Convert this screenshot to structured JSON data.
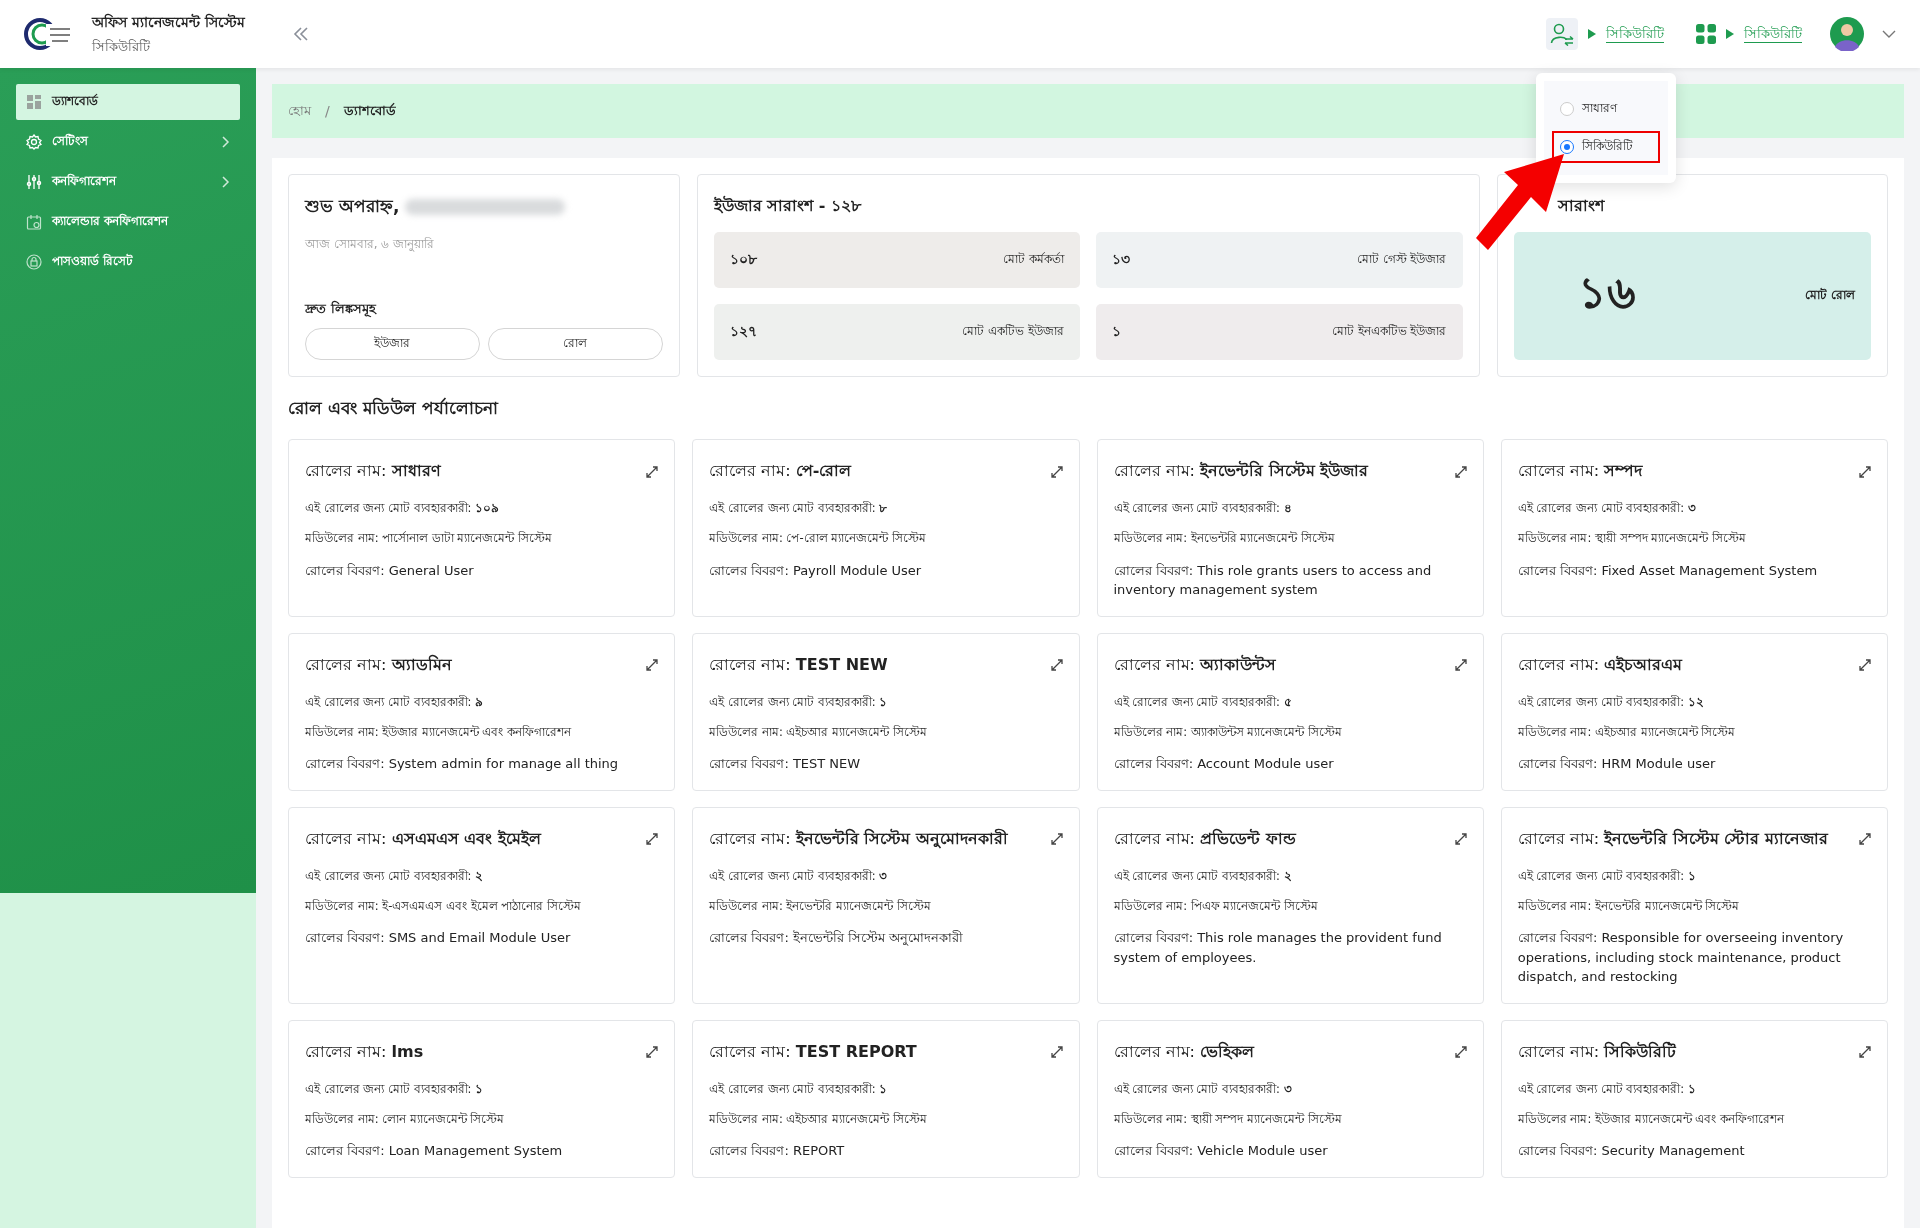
{
  "header": {
    "title": "অফিস ম্যানেজমেন্ট সিস্টেম",
    "subtitle": "সিকিউরিটি",
    "links": [
      "সিকিউরিটি",
      "সিকিউরিটি"
    ]
  },
  "role_menu": {
    "options": [
      {
        "label": "সাধারণ",
        "selected": false,
        "highlighted": false
      },
      {
        "label": "সিকিউরিটি",
        "selected": true,
        "highlighted": true
      }
    ]
  },
  "sidebar": {
    "items": [
      {
        "label": "ড্যাশবোর্ড",
        "selected": true,
        "expandable": false
      },
      {
        "label": "সেটিংস",
        "selected": false,
        "expandable": true
      },
      {
        "label": "কনফিগারেশন",
        "selected": false,
        "expandable": true
      },
      {
        "label": "ক্যালেন্ডার কনফিগারেশন",
        "selected": false,
        "expandable": false
      },
      {
        "label": "পাসওয়ার্ড রিসেট",
        "selected": false,
        "expandable": false
      }
    ]
  },
  "breadcrumb": [
    "হোম",
    "/",
    "ড্যাশবোর্ড"
  ],
  "welcome": {
    "greeting": "শুভ অপরাহ্ন,",
    "date": "আজ সোমবার, ৬ জানুয়ারি",
    "quick_links_title": "দ্রুত লিঙ্কসমূহ",
    "quick_links": [
      "ইউজার",
      "রোল"
    ]
  },
  "user_summary": {
    "title": "ইউজার সারাংশ - ১২৮",
    "stats": [
      {
        "count": "১০৮",
        "caption": "মোট কর্মকর্তা"
      },
      {
        "count": "১৩",
        "caption": "মোট গেস্ট ইউজার"
      },
      {
        "count": "১২৭",
        "caption": "মোট একটিভ ইউজার"
      },
      {
        "count": "১",
        "caption": "মোট ইনএকটিভ ইউজার"
      }
    ]
  },
  "role_summary": {
    "title": "সারাংশ",
    "value": "১৬",
    "label": "মোট রোল"
  },
  "section_title": "রোল এবং মডিউল পর্যালোচনা",
  "roles": [
    {
      "name": "রোলের নাম: **সাধারণ**",
      "users": "এই রোলের জন্য মোট ব্যবহারকারী: **১০৯**",
      "module": "মডিউলের নাম: পার্সোনাল ডাটা ম্যানেজমেন্ট সিস্টেম",
      "description": "রোলের বিবরণ: General User"
    },
    {
      "name": "রোলের নাম: **পে-রোল**",
      "users": "এই রোলের জন্য মোট ব্যবহারকারী: **৮**",
      "module": "মডিউলের নাম: পে-রোল ম্যানেজমেন্ট সিস্টেম",
      "description": "রোলের বিবরণ: Payroll Module User"
    },
    {
      "name": "রোলের নাম: **ইনভেন্টরি সিস্টেম ইউজার**",
      "users": "এই রোলের জন্য মোট ব্যবহারকারী: **৪**",
      "module": "মডিউলের নাম: ইনভেন্টরি ম্যানেজমেন্ট সিস্টেম",
      "description": "রোলের বিবরণ: This role grants users to access and inventory management system"
    },
    {
      "name": "রোলের নাম: **সম্পদ**",
      "users": "এই রোলের জন্য মোট ব্যবহারকারী: **৩**",
      "module": "মডিউলের নাম: স্থায়ী সম্পদ ম্যানেজমেন্ট সিস্টেম",
      "description": "রোলের বিবরণ: Fixed Asset Management System"
    },
    {
      "name": "রোলের নাম: **অ্যাডমিন**",
      "users": "এই রোলের জন্য মোট ব্যবহারকারী: **৯**",
      "module": "মডিউলের নাম: ইউজার ম্যানেজমেন্ট এবং কনফিগারেশন",
      "description": "রোলের বিবরণ: System admin for manage all thing"
    },
    {
      "name": "রোলের নাম: **TEST NEW**",
      "users": "এই রোলের জন্য মোট ব্যবহারকারী: **১**",
      "module": "মডিউলের নাম: এইচআর ম্যানেজমেন্ট সিস্টেম",
      "description": "রোলের বিবরণ: TEST NEW"
    },
    {
      "name": "রোলের নাম: **অ্যাকাউন্টস**",
      "users": "এই রোলের জন্য মোট ব্যবহারকারী: **৫**",
      "module": "মডিউলের নাম: অ্যাকাউন্টস ম্যানেজমেন্ট সিস্টেম",
      "description": "রোলের বিবরণ: Account Module user"
    },
    {
      "name": "রোলের নাম: **এইচআরএম**",
      "users": "এই রোলের জন্য মোট ব্যবহারকারী: **১২**",
      "module": "মডিউলের নাম: এইচআর ম্যানেজমেন্ট সিস্টেম",
      "description": "রোলের বিবরণ: HRM Module user"
    },
    {
      "name": "রোলের নাম: **এসএমএস এবং ইমেইল**",
      "users": "এই রোলের জন্য মোট ব্যবহারকারী: **২**",
      "module": "মডিউলের নাম: ই-এসএমএস এবং ইমেল পাঠানোর সিস্টেম",
      "description": "রোলের বিবরণ: SMS and Email Module User"
    },
    {
      "name": "রোলের নাম: **ইনভেন্টরি সিস্টেম অনুমোদনকারী**",
      "users": "এই রোলের জন্য মোট ব্যবহারকারী: **৩**",
      "module": "মডিউলের নাম: ইনভেন্টরি ম্যানেজমেন্ট সিস্টেম",
      "description": "রোলের বিবরণ: ইনভেন্টরি সিস্টেম অনুমোদনকারী"
    },
    {
      "name": "রোলের নাম: **প্রভিডেন্ট ফান্ড**",
      "users": "এই রোলের জন্য মোট ব্যবহারকারী: **২**",
      "module": "মডিউলের নাম: পিএফ ম্যানেজমেন্ট সিস্টেম",
      "description": "রোলের বিবরণ: This role manages the provident fund system of employees."
    },
    {
      "name": "রোলের নাম: **ইনভেন্টরি সিস্টেম স্টোর ম্যানেজার**",
      "users": "এই রোলের জন্য মোট ব্যবহারকারী: **১**",
      "module": "মডিউলের নাম: ইনভেন্টরি ম্যানেজমেন্ট সিস্টেম",
      "description": "রোলের বিবরণ: Responsible for overseeing inventory operations, including stock maintenance, product dispatch, and restocking"
    },
    {
      "name": "রোলের নাম: **lms**",
      "users": "এই রোলের জন্য মোট ব্যবহারকারী: **১**",
      "module": "মডিউলের নাম: লোন ম্যানেজমেন্ট সিস্টেম",
      "description": "রোলের বিবরণ: Loan Management System"
    },
    {
      "name": "রোলের নাম: **TEST REPORT**",
      "users": "এই রোলের জন্য মোট ব্যবহারকারী: **১**",
      "module": "মডিউলের নাম: এইচআর ম্যানেজমেন্ট সিস্টেম",
      "description": "রোলের বিবরণ: REPORT"
    },
    {
      "name": "রোলের নাম: **ভেহিকল**",
      "users": "এই রোলের জন্য মোট ব্যবহারকারী: **৩**",
      "module": "মডিউলের নাম: স্থায়ী সম্পদ ম্যানেজমেন্ট সিস্টেম",
      "description": "রোলের বিবরণ: Vehicle Module user"
    },
    {
      "name": "রোলের নাম: **সিকিউরিটি**",
      "users": "এই রোলের জন্য মোট ব্যবহারকারী: **১**",
      "module": "মডিউলের নাম: ইউজার ম্যানেজমেন্ট এবং কনফিগারেশন",
      "description": "রোলের বিবরণ: Security Management"
    }
  ]
}
